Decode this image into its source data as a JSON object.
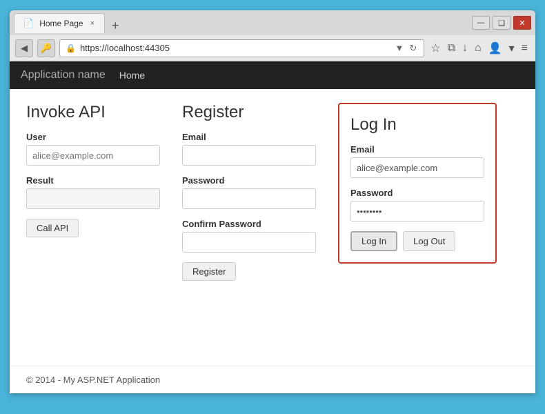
{
  "browser": {
    "tab_label": "Home Page",
    "tab_close": "×",
    "new_tab": "+",
    "win_minimize": "—",
    "win_maximize": "❑",
    "win_close": "✕",
    "address": "https://localhost:44305",
    "back_icon": "◀",
    "key_icon": "🔑",
    "lock_icon": "🔒",
    "refresh_icon": "↻",
    "dropdown_icon": "▼",
    "star_icon": "☆",
    "clipboard_icon": "⧉",
    "download_icon": "↓",
    "home_icon": "⌂",
    "avatar_icon": "👤",
    "settings_icon": "≡"
  },
  "app_navbar": {
    "app_name": "Application name",
    "nav_home": "Home"
  },
  "invoke_api": {
    "title": "Invoke API",
    "user_label": "User",
    "user_placeholder": "alice@example.com",
    "result_label": "Result",
    "call_api_btn": "Call API"
  },
  "register": {
    "title": "Register",
    "email_label": "Email",
    "password_label": "Password",
    "confirm_password_label": "Confirm Password",
    "register_btn": "Register"
  },
  "login": {
    "title": "Log In",
    "email_label": "Email",
    "email_value": "alice@example.com",
    "password_label": "Password",
    "password_value": "••••••••",
    "login_btn": "Log In",
    "logout_btn": "Log Out"
  },
  "footer": {
    "text": "© 2014 - My ASP.NET Application"
  }
}
